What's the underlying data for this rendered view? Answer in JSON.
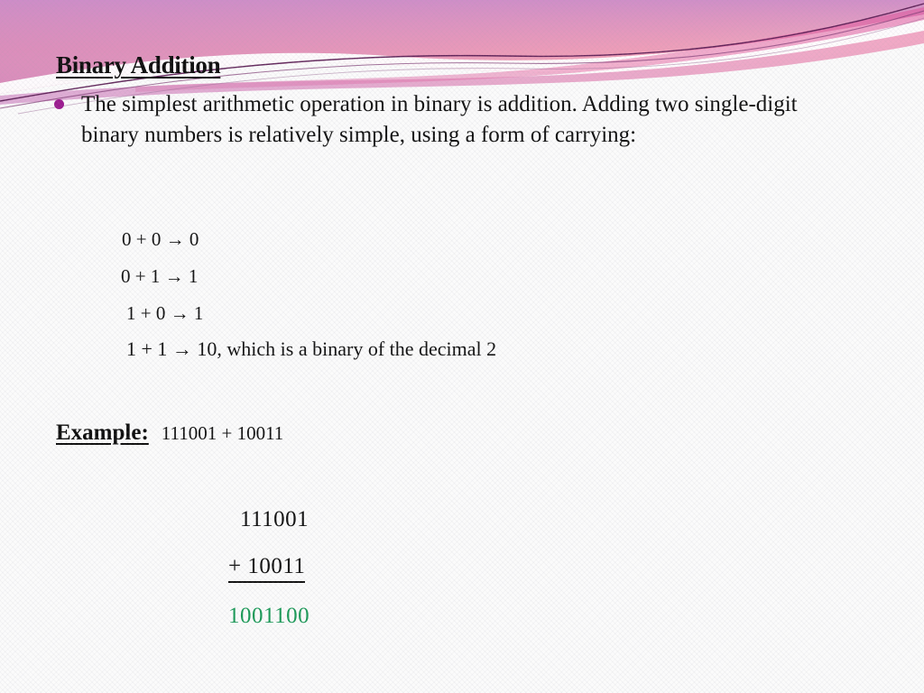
{
  "slide": {
    "title": "Binary Addition",
    "bullet": "The simplest arithmetic operation in binary is addition. Adding two single-digit binary numbers is relatively simple, using a form of carrying:",
    "rules": [
      "0 + 0 → 0",
      "0 + 1 → 1",
      "1 + 0 → 1",
      "1 + 1 → 10, which is a binary of the decimal 2"
    ],
    "example": {
      "label": "Example:",
      "expression": "111001 + 10011"
    },
    "sum": {
      "addend_1": "111001",
      "addend_2": "+ 10011",
      "result": "1001100"
    }
  },
  "colors": {
    "bullet": "#9B1B8F",
    "result_green": "#1a9957",
    "band_magenta": "#C96DB4",
    "band_pink": "#F09AB0",
    "band_deep_pink": "#E2579A",
    "band_lilac": "#C9A8CE",
    "line_dark_purple": "#5B1E54",
    "background": "#FBFBFB",
    "text": "#0F0F0F"
  }
}
